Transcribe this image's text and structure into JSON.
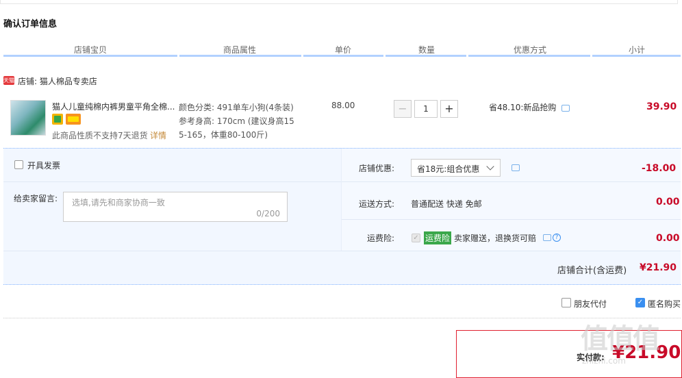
{
  "section_title": "确认订单信息",
  "columns": [
    "店铺宝贝",
    "商品属性",
    "单价",
    "数量",
    "优惠方式",
    "小计"
  ],
  "shop": {
    "badge": "天猫",
    "name": "店铺: 猫人棉品专卖店"
  },
  "item": {
    "name": "猫人儿童纯棉内裤男童平角全棉...",
    "no_return": "此商品性质不支持7天退货",
    "detail_link": "详情",
    "attr_line1": "颜色分类: 491单车小狗(4条装)",
    "attr_line2": "参考身高: 170cm (建议身高15",
    "attr_line3": "5-165，体重80-100斤)",
    "price": "88.00",
    "qty_minus": "−",
    "qty": "1",
    "qty_plus": "+",
    "promo": "省48.10:新品抢购",
    "subtotal": "39.90"
  },
  "invoice_label": "开具发票",
  "message": {
    "label": "给卖家留言:",
    "placeholder": "选填,请先和商家协商一致",
    "count": "0/200"
  },
  "shop_discount": {
    "label": "店铺优惠:",
    "selected": "省18元:组合优惠",
    "amount": "-18.00"
  },
  "shipping": {
    "label": "运送方式:",
    "value": "普通配送 快递 免邮",
    "amount": "0.00"
  },
  "insurance": {
    "label": "运费险:",
    "tag": "运费险",
    "text": "卖家赠送，退换货可赔",
    "help": "?",
    "amount": "0.00"
  },
  "shop_total": {
    "label": "店铺合计(含运费)",
    "amount": "¥21.90"
  },
  "friend_pay": "朋友代付",
  "anonymous": "匿名购买",
  "pay": {
    "label": "实付款:",
    "amount": "¥21.90"
  },
  "watermark": {
    "logo": "值值值",
    "site": "zhizhi.com"
  }
}
